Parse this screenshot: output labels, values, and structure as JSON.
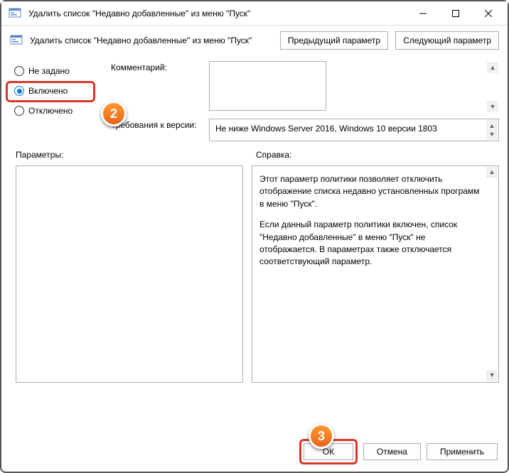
{
  "window": {
    "title": "Удалить список \"Недавно добавленные\" из меню \"Пуск\""
  },
  "header": {
    "title": "Удалить список \"Недавно добавленные\" из меню \"Пуск\"",
    "prev": "Предыдущий параметр",
    "next": "Следующий параметр"
  },
  "radios": {
    "not_configured": "Не задано",
    "enabled": "Включено",
    "disabled": "Отключено"
  },
  "fields": {
    "comment_label": "Комментарий:",
    "comment_value": "",
    "version_label": "Требования к версии:",
    "version_value": "Не ниже Windows Server 2016, Windows 10 версии 1803"
  },
  "mid": {
    "options": "Параметры:",
    "help": "Справка:"
  },
  "help": {
    "p1": "Этот параметр политики позволяет отключить отображение списка недавно установленных программ в меню \"Пуск\".",
    "p2": "Если данный параметр политики включен, список \"Недавно добавленные\" в меню \"Пуск\" не отображается.  В параметрах также отключается соответствующий параметр."
  },
  "buttons": {
    "ok": "ОК",
    "cancel": "Отмена",
    "apply": "Применить"
  },
  "steps": {
    "s2": "2",
    "s3": "3"
  }
}
